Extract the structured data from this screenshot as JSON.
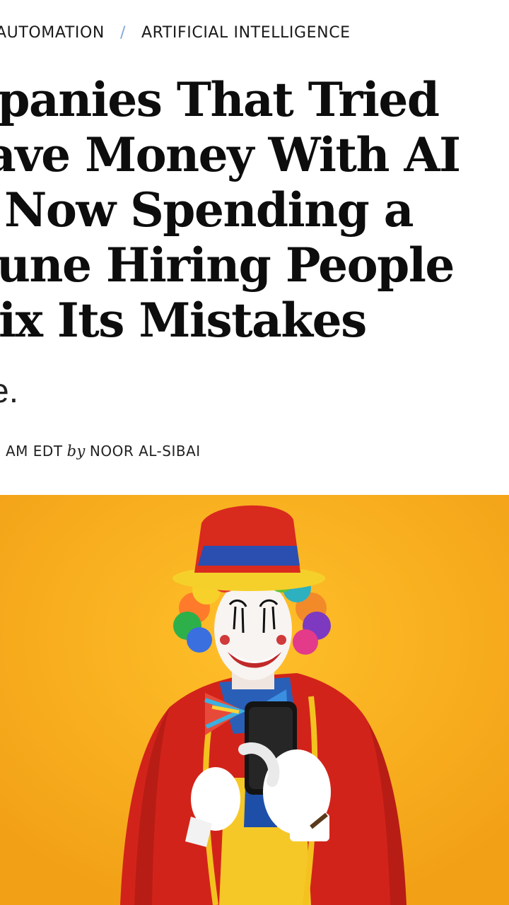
{
  "breadcrumb": {
    "items": [
      "AUTOMATION",
      "ARTIFICIAL INTELLIGENCE"
    ],
    "separator": "/"
  },
  "headline": {
    "lines": [
      "mpanies That Tried",
      "ave Money With AI",
      "Now Spending a",
      "tune Hiring People",
      "ix Its Mistakes"
    ]
  },
  "dek": "e.",
  "byline": {
    "time": "AM EDT",
    "by": "by",
    "author": "NOOR AL-SIBAI"
  },
  "hero": {
    "background_color": "#f5a91a",
    "subject": "clown-holding-smartphone"
  }
}
